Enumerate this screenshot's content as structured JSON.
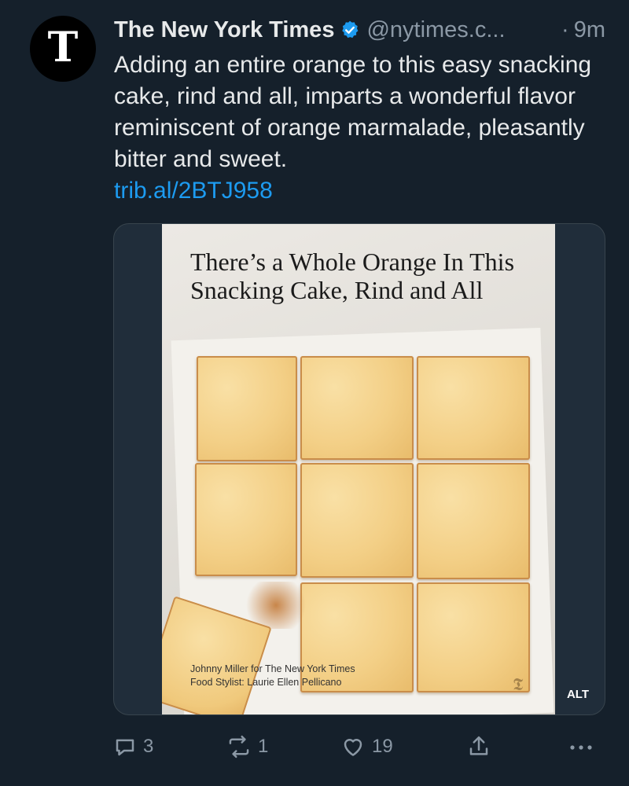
{
  "tweet": {
    "author_name": "The New York Times",
    "avatar_glyph": "T",
    "handle": "@nytimes.c...",
    "time_sep": "·",
    "time": "9m",
    "text": "Adding an entire orange to this easy snacking cake, rind and all, imparts a wonderful flavor reminiscent of orange marmalade, pleasantly bitter and sweet.",
    "link": "trib.al/2BTJ958"
  },
  "media": {
    "headline": "There’s a Whole Orange In This Snacking Cake, Rind and All",
    "credit_line1": "Johnny Miller for The New York Times",
    "credit_line2": "Food Stylist: Laurie Ellen Pellicano",
    "alt_badge": "ALT"
  },
  "actions": {
    "reply_count": "3",
    "retweet_count": "1",
    "like_count": "19"
  },
  "icons": {
    "verified": "verified-badge-icon",
    "reply": "reply-icon",
    "retweet": "retweet-icon",
    "like": "heart-icon",
    "share": "share-icon",
    "more": "more-icon"
  },
  "colors": {
    "background": "#15202b",
    "text": "#e7e9ea",
    "secondary": "#8b98a5",
    "link": "#1d9bf0"
  }
}
